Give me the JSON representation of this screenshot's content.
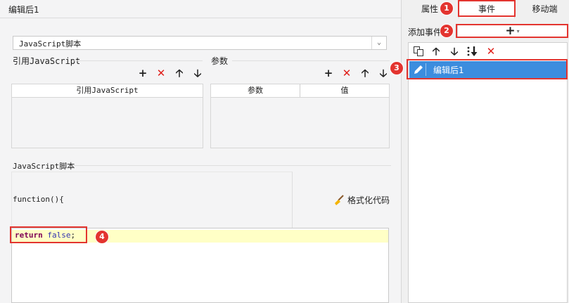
{
  "left_panel": {
    "title": "编辑后1",
    "script_type_value": "JavaScript脚本",
    "ref_section_label": "引用JavaScript",
    "param_section_label": "参数",
    "ref_table": {
      "headers": [
        "引用JavaScript"
      ]
    },
    "param_table": {
      "headers": [
        "参数",
        "值"
      ]
    },
    "script_section_label": "JavaScript脚本",
    "function_header": "function(){",
    "format_button_label": "格式化代码",
    "code": {
      "keyword": "return",
      "value": "false",
      "tail": ";"
    }
  },
  "right_panel": {
    "tabs": [
      "属性",
      "事件",
      "移动端"
    ],
    "add_event_label": "添加事件",
    "add_button_glyph": "+",
    "event_items": [
      "编辑后1"
    ]
  },
  "annotations": [
    "1",
    "2",
    "3",
    "4"
  ],
  "colors": {
    "annotation_red": "#e3342f",
    "selection_blue": "#3c8dde",
    "delete_red": "#e0201b",
    "code_highlight": "#ffffc6"
  }
}
